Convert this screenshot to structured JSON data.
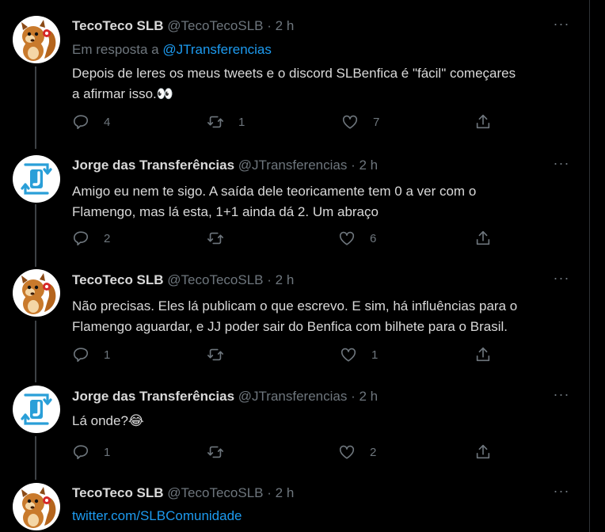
{
  "tweets": [
    {
      "name": "TecoTeco SLB",
      "handle": "@TecoTecoSLB",
      "dot": "·",
      "time": "2 h",
      "more": "···",
      "reply_prefix": "Em resposta a ",
      "reply_to": "@JTransferencias",
      "lines": [
        "Depois de leres os meus tweets e o discord SLBenfica é \"fácil\" começares",
        "a afirmar isso.👀"
      ],
      "replies": "4",
      "retweets": "1",
      "likes": "7",
      "avatar": "squirrel"
    },
    {
      "name": "Jorge das Transferências",
      "handle": "@JTransferencias",
      "dot": "·",
      "time": "2 h",
      "more": "···",
      "lines": [
        "Amigo eu nem te sigo. A saída dele teoricamente tem 0 a ver com o",
        "Flamengo, mas lá esta, 1+1 ainda dá 2. Um abraço"
      ],
      "replies": "2",
      "retweets": "",
      "likes": "6",
      "avatar": "jt-logo"
    },
    {
      "name": "TecoTeco SLB",
      "handle": "@TecoTecoSLB",
      "dot": "·",
      "time": "2 h",
      "more": "···",
      "lines": [
        "Não precisas. Eles lá publicam o que escrevo. E sim, há influências para o",
        "Flamengo aguardar, e JJ poder sair do Benfica com bilhete para o Brasil."
      ],
      "replies": "1",
      "retweets": "",
      "likes": "1",
      "avatar": "squirrel"
    },
    {
      "name": "Jorge das Transferências",
      "handle": "@JTransferencias",
      "dot": "·",
      "time": "2 h",
      "more": "···",
      "lines": [
        "Lá onde?😂"
      ],
      "replies": "1",
      "retweets": "",
      "likes": "2",
      "avatar": "jt-logo"
    },
    {
      "name": "TecoTeco SLB",
      "handle": "@TecoTecoSLB",
      "dot": "·",
      "time": "2 h",
      "more": "···",
      "link": "twitter.com/SLBComunidade",
      "avatar": "squirrel"
    }
  ],
  "colors": {
    "background": "#000000",
    "text": "#d9d9d9",
    "muted": "#6e767d",
    "link": "#1d9bf0",
    "divider": "#2f3336"
  },
  "icons": [
    "reply-icon",
    "retweet-icon",
    "like-icon",
    "share-icon",
    "more-icon"
  ]
}
